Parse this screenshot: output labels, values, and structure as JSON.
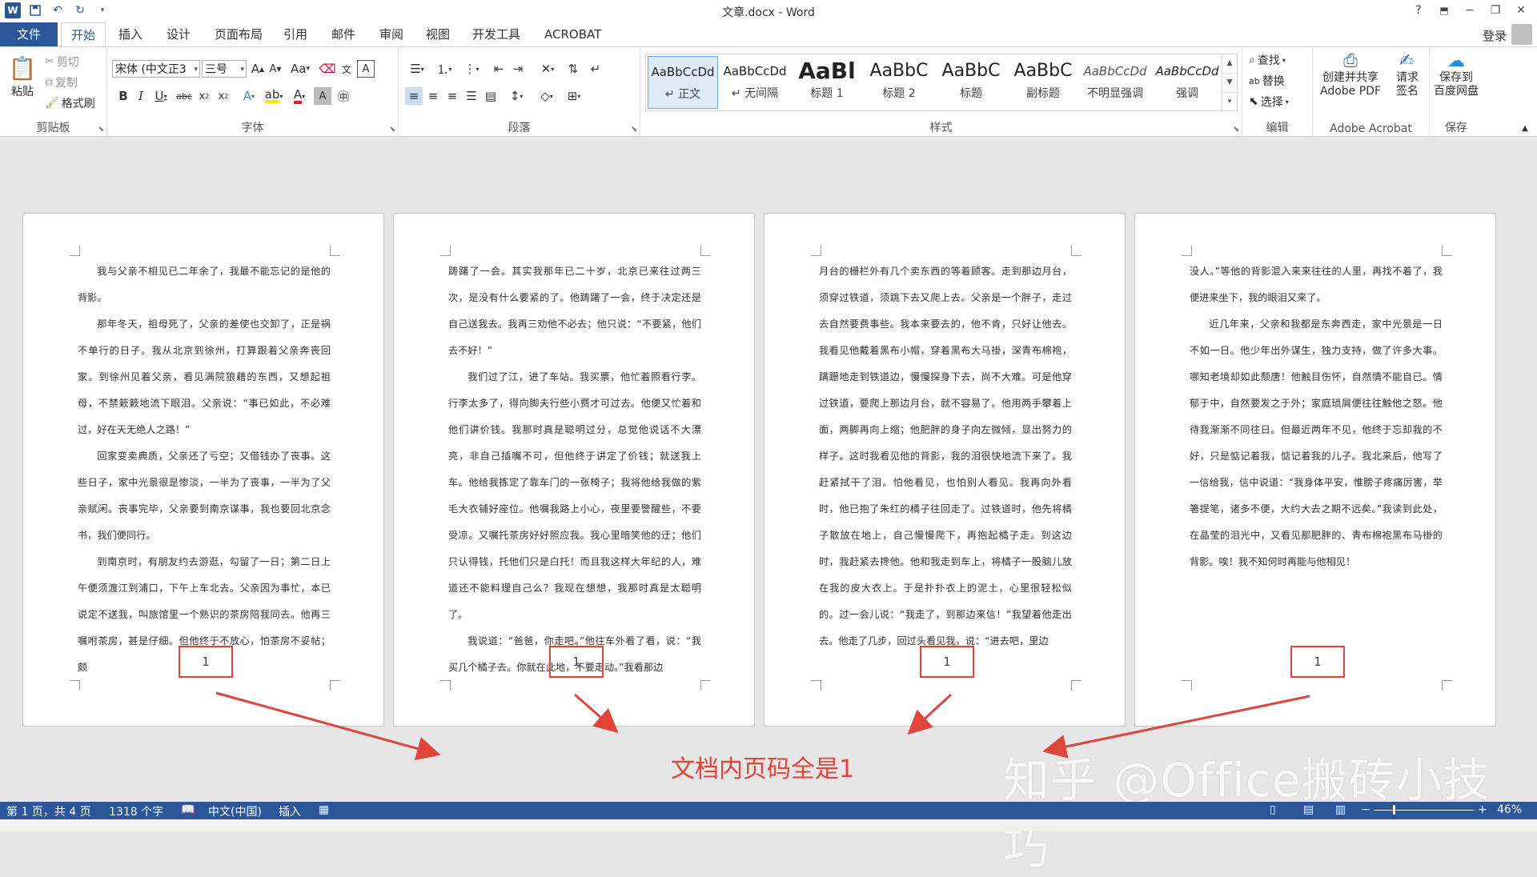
{
  "window": {
    "title": "文章.docx - Word",
    "help": "?",
    "minimize": "−",
    "restore": "❐",
    "close": "✕",
    "signin": "登录"
  },
  "tabs": [
    "文件",
    "开始",
    "插入",
    "设计",
    "页面布局",
    "引用",
    "邮件",
    "审阅",
    "视图",
    "开发工具",
    "ACROBAT"
  ],
  "ribbon": {
    "clipboard": {
      "label": "剪贴板",
      "paste": "粘贴",
      "cut": "剪切",
      "copy": "复制",
      "format_painter": "格式刷"
    },
    "font": {
      "label": "字体",
      "font_name": "宋体 (中文正3",
      "font_size": "三号",
      "change_case": "Aa"
    },
    "paragraph": {
      "label": "段落"
    },
    "styles": {
      "label": "样式",
      "items": [
        {
          "sample": "AaBbCcDd",
          "name": "↵ 正文"
        },
        {
          "sample": "AaBbCcDd",
          "name": "↵ 无间隔"
        },
        {
          "sample": "AaBl",
          "name": "标题 1"
        },
        {
          "sample": "AaBbC",
          "name": "标题 2"
        },
        {
          "sample": "AaBbC",
          "name": "标题"
        },
        {
          "sample": "AaBbC",
          "name": "副标题"
        },
        {
          "sample": "AaBbCcDd",
          "name": "不明显强调"
        },
        {
          "sample": "AaBbCcDd",
          "name": "强调"
        }
      ]
    },
    "editing": {
      "label": "编辑",
      "find": "查找",
      "replace": "替换",
      "select": "选择"
    },
    "acrobat": {
      "label": "Adobe Acrobat",
      "create_share": "创建并共享",
      "create_share2": "Adobe PDF",
      "request_sign": "请求",
      "request_sign2": "签名"
    },
    "save": {
      "label": "保存",
      "save_baidu": "保存到",
      "save_baidu2": "百度网盘"
    }
  },
  "pages": [
    {
      "paragraphs": [
        {
          "indent": true,
          "text": "我与父亲不相见已二年余了，我最不能忘记的是他的背影。"
        },
        {
          "indent": true,
          "text": "那年冬天，祖母死了，父亲的差使也交卸了，正是祸不单行的日子。我从北京到徐州，打算跟着父亲奔丧回家。到徐州见着父亲，看见满院狼藉的东西，又想起祖母，不禁簌簌地流下眼泪。父亲说：“事已如此，不必难过，好在天无绝人之路！”"
        },
        {
          "indent": true,
          "text": "回家变卖典质，父亲还了亏空；又借钱办了丧事。这些日子，家中光景很是惨淡，一半为了丧事，一半为了父亲赋闲。丧事完毕，父亲要到南京谋事，我也要回北京念书，我们便同行。"
        },
        {
          "indent": true,
          "text": "到南京时，有朋友约去游逛，勾留了一日；第二日上午便须渡江到浦口，下午上车北去。父亲因为事忙，本已说定不送我，叫旅馆里一个熟识的茶房陪我同去。他再三嘱咐茶房，甚是仔细。但他终于不放心，怕茶房不妥帖；颇"
        }
      ],
      "page_number": "1"
    },
    {
      "paragraphs": [
        {
          "indent": false,
          "text": "踌躇了一会。其实我那年已二十岁，北京已来往过两三次，是没有什么要紧的了。他踌躇了一会，终于决定还是自己送我去。我再三劝他不必去；他只说：“不要紧，他们去不好！”"
        },
        {
          "indent": true,
          "text": "我们过了江，进了车站。我买票，他忙着照看行李。行李太多了，得向脚夫行些小费才可过去。他便又忙着和他们讲价钱。我那时真是聪明过分，总觉他说话不大漂亮，非自己插嘴不可，但他终于讲定了价钱；就送我上车。他给我拣定了靠车门的一张椅子；我将他给我做的紫毛大衣铺好座位。他嘱我路上小心，夜里要警醒些，不要受凉。又嘱托茶房好好照应我。我心里暗笑他的迂；他们只认得钱，托他们只是白托！而且我这样大年纪的人，难道还不能料理自己么？我现在想想，我那时真是太聪明了。"
        },
        {
          "indent": true,
          "text": "我说道：“爸爸，你走吧。”他往车外看了看，说：“我买几个橘子去。你就在此地，不要走动。”我看那边"
        }
      ],
      "page_number": "1"
    },
    {
      "paragraphs": [
        {
          "indent": false,
          "text": "月台的栅栏外有几个卖东西的等着顾客。走到那边月台，须穿过铁道，须跳下去又爬上去。父亲是一个胖子，走过去自然要费事些。我本来要去的，他不肯，只好让他去。我看见他戴着黑布小帽，穿着黑布大马褂，深青布棉袍，蹒跚地走到铁道边，慢慢探身下去，尚不大难。可是他穿过铁道，要爬上那边月台，就不容易了。他用两手攀着上面，两脚再向上缩；他肥胖的身子向左微倾，显出努力的样子。这时我看见他的背影，我的泪很快地流下来了。我赶紧拭干了泪。怕他看见，也怕别人看见。我再向外看时，他已抱了朱红的橘子往回走了。过铁道时，他先将橘子散放在地上，自己慢慢爬下，再抱起橘子走。到这边时，我赶紧去搀他。他和我走到车上，将橘子一股脑儿放在我的皮大衣上。于是扑扑衣上的泥土，心里很轻松似的。过一会儿说：“我走了，到那边来信！”我望着他走出去。他走了几步，回过头看见我，说：“进去吧，里边"
        }
      ],
      "page_number": "1"
    },
    {
      "paragraphs": [
        {
          "indent": false,
          "text": "没人。”等他的背影混入来来往往的人里，再找不着了，我便进来坐下，我的眼泪又来了。"
        },
        {
          "indent": true,
          "text": "近几年来，父亲和我都是东奔西走，家中光景是一日不如一日。他少年出外谋生，独力支持，做了许多大事。哪知老境却如此颓唐！他触目伤怀，自然情不能自已。情郁于中，自然要发之于外；家庭琐屑便往往触他之怒。他待我渐渐不同往日。但最近两年不见，他终于忘却我的不好，只是惦记着我，惦记着我的儿子。我北来后，他写了一信给我，信中说道：“我身体平安，惟膀子疼痛厉害，举箸提笔，诸多不便，大约大去之期不远矣。”我读到此处，在晶莹的泪光中，又看见那肥胖的、青布棉袍黑布马褂的背影。唉！我不知何时再能与他相见！"
        }
      ],
      "page_number": "1"
    }
  ],
  "annotation": {
    "caption": "文档内页码全是1",
    "watermark": "知乎 @Office搬砖小技巧",
    "color": "#e0443a"
  },
  "statusbar": {
    "page": "第 1 页，共 4 页",
    "words": "1318 个字",
    "language": "中文(中国)",
    "mode": "插入",
    "zoom": "46%",
    "zoom_out": "−",
    "zoom_in": "+"
  }
}
